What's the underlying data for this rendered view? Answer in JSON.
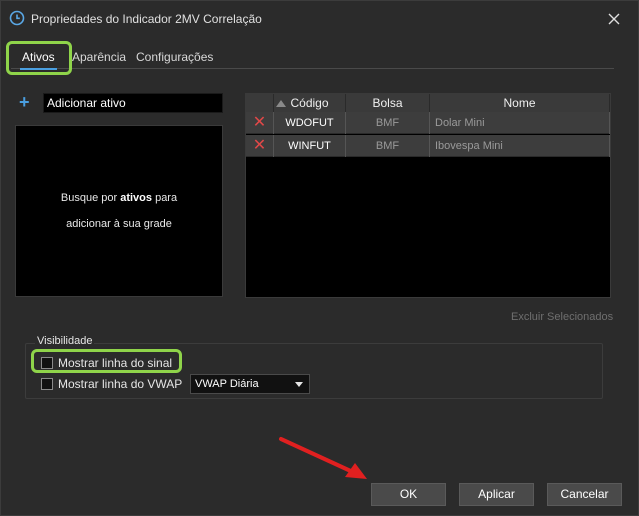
{
  "window": {
    "title": "Propriedades do Indicador 2MV Correlação"
  },
  "tabs": [
    {
      "label": "Ativos",
      "active": true
    },
    {
      "label": "Aparência",
      "active": false
    },
    {
      "label": "Configurações",
      "active": false
    }
  ],
  "ativos": {
    "add_label": "Adicionar ativo",
    "search_hint_pre": "Busque por ",
    "search_hint_bold": "ativos",
    "search_hint_post": " para",
    "search_hint_line2": "adicionar à sua grade"
  },
  "grid": {
    "columns": [
      "",
      "Código",
      "Bolsa",
      "Nome"
    ],
    "rows": [
      {
        "codigo": "WDOFUT",
        "bolsa": "BMF",
        "nome": "Dolar Mini"
      },
      {
        "codigo": "WINFUT",
        "bolsa": "BMF",
        "nome": "Ibovespa Mini"
      }
    ],
    "delete_selected": "Excluir Selecionados"
  },
  "visibility": {
    "legend": "Visibilidade",
    "signal_line": {
      "label": "Mostrar linha do sinal",
      "checked": false
    },
    "vwap_line": {
      "label": "Mostrar linha do VWAP",
      "checked": false
    },
    "vwap_select": "VWAP Diária"
  },
  "buttons": {
    "ok": "OK",
    "apply": "Aplicar",
    "cancel": "Cancelar"
  },
  "colors": {
    "highlight": "#8fd44a",
    "accent": "#4a9fe0",
    "delete": "#e04848",
    "arrow": "#e02020"
  }
}
